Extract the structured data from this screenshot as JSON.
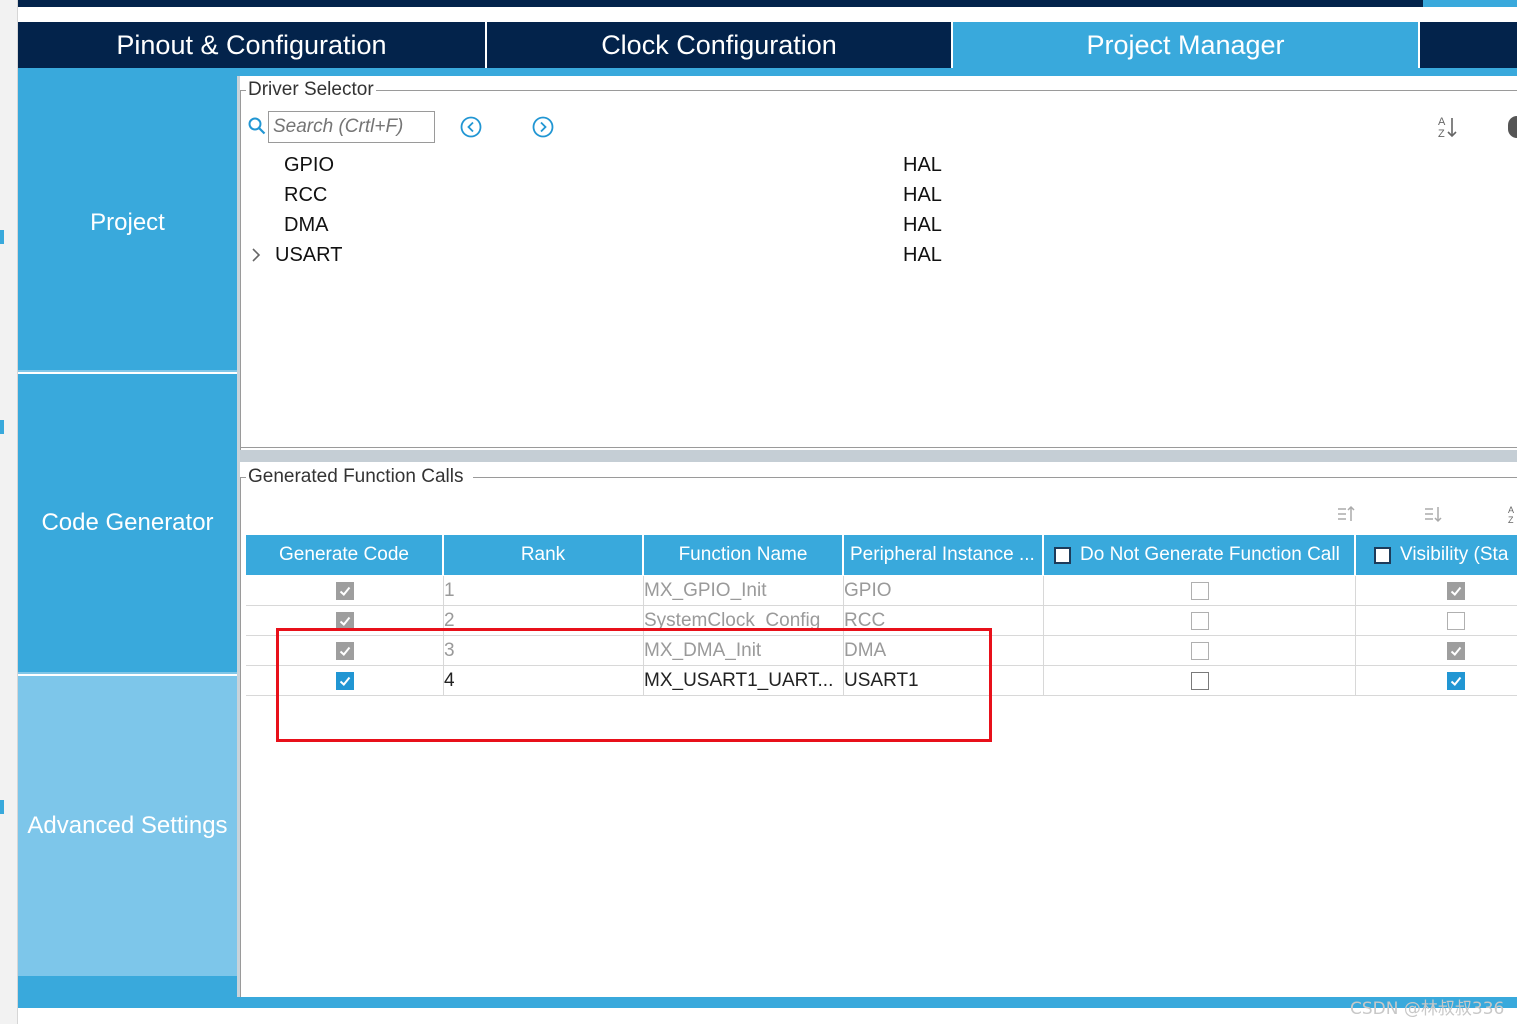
{
  "tabs": [
    {
      "label": "Pinout & Configuration"
    },
    {
      "label": "Clock Configuration"
    },
    {
      "label": "Project Manager"
    },
    {
      "label": ""
    }
  ],
  "sidebar": {
    "items": [
      {
        "label": "Project"
      },
      {
        "label": "Code Generator"
      },
      {
        "label": "Advanced Settings"
      }
    ]
  },
  "driver_selector": {
    "title": "Driver Selector",
    "search_placeholder": "Search (Crtl+F)",
    "drivers": [
      {
        "name": "GPIO",
        "type": "HAL",
        "expandable": false
      },
      {
        "name": "RCC",
        "type": "HAL",
        "expandable": false
      },
      {
        "name": "DMA",
        "type": "HAL",
        "expandable": false
      },
      {
        "name": "USART",
        "type": "HAL",
        "expandable": true
      }
    ]
  },
  "generated_calls": {
    "title": "Generated Function Calls",
    "columns": [
      "Generate Code",
      "Rank",
      "Function Name",
      "Peripheral Instance ...",
      "Do Not Generate Function Call",
      "Visibility (Sta"
    ],
    "rows": [
      {
        "generate": "checked-gray",
        "rank": "1",
        "function": "MX_GPIO_Init",
        "instance": "GPIO",
        "do_not_generate": "empty-gray",
        "visibility": "checked-gray",
        "dim": true
      },
      {
        "generate": "checked-gray",
        "rank": "2",
        "function": "SystemClock_Config",
        "instance": "RCC",
        "do_not_generate": "empty-gray",
        "visibility": "empty-gray",
        "dim": true
      },
      {
        "generate": "checked-gray",
        "rank": "3",
        "function": "MX_DMA_Init",
        "instance": "DMA",
        "do_not_generate": "empty-gray",
        "visibility": "checked-gray",
        "dim": true
      },
      {
        "generate": "checked-blue",
        "rank": "4",
        "function": "MX_USART1_UART...",
        "instance": "USART1",
        "do_not_generate": "empty",
        "visibility": "checked-blue",
        "dim": false
      }
    ]
  },
  "watermark": "CSDN @林叔叔336",
  "colors": {
    "navy": "#03234b",
    "accent": "#39a9dc",
    "accent_light": "#7dc6ea",
    "highlight": "#e8101a"
  }
}
